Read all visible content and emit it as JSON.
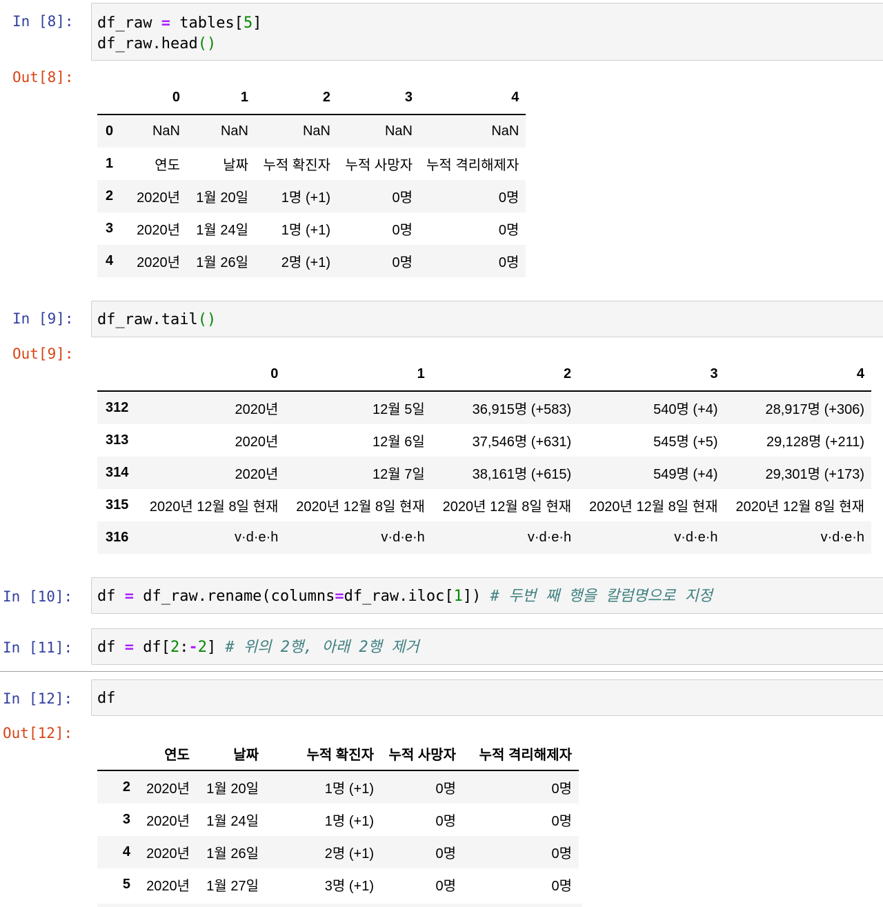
{
  "cells": {
    "c8": {
      "in_prompt": "In [8]:",
      "code_line1_a": "df_raw ",
      "code_line1_op": "=",
      "code_line1_b": " tables[",
      "code_line1_num": "5",
      "code_line1_c": "]",
      "code_line2_a": "df_raw.head",
      "code_line2_paren": "()",
      "out_prompt": "Out[8]:",
      "table": {
        "columns": [
          "0",
          "1",
          "2",
          "3",
          "4"
        ],
        "rows": [
          {
            "index": "0",
            "values": [
              "NaN",
              "NaN",
              "NaN",
              "NaN",
              "NaN"
            ]
          },
          {
            "index": "1",
            "values": [
              "연도",
              "날짜",
              "누적 확진자",
              "누적 사망자",
              "누적 격리해제자"
            ]
          },
          {
            "index": "2",
            "values": [
              "2020년",
              "1월 20일",
              "1명 (+1)",
              "0명",
              "0명"
            ]
          },
          {
            "index": "3",
            "values": [
              "2020년",
              "1월 24일",
              "1명 (+1)",
              "0명",
              "0명"
            ]
          },
          {
            "index": "4",
            "values": [
              "2020년",
              "1월 26일",
              "2명 (+1)",
              "0명",
              "0명"
            ]
          }
        ]
      }
    },
    "c9": {
      "in_prompt": "In [9]:",
      "code_a": "df_raw.tail",
      "code_paren": "()",
      "out_prompt": "Out[9]:",
      "table": {
        "columns": [
          "0",
          "1",
          "2",
          "3",
          "4"
        ],
        "rows": [
          {
            "index": "312",
            "values": [
              "2020년",
              "12월 5일",
              "36,915명 (+583)",
              "540명 (+4)",
              "28,917명 (+306)"
            ]
          },
          {
            "index": "313",
            "values": [
              "2020년",
              "12월 6일",
              "37,546명 (+631)",
              "545명 (+5)",
              "29,128명 (+211)"
            ]
          },
          {
            "index": "314",
            "values": [
              "2020년",
              "12월 7일",
              "38,161명 (+615)",
              "549명 (+4)",
              "29,301명 (+173)"
            ]
          },
          {
            "index": "315",
            "values": [
              "2020년 12월 8일 현재",
              "2020년 12월 8일 현재",
              "2020년 12월 8일 현재",
              "2020년 12월 8일 현재",
              "2020년 12월 8일 현재"
            ]
          },
          {
            "index": "316",
            "values": [
              "v·d·e·h",
              "v·d·e·h",
              "v·d·e·h",
              "v·d·e·h",
              "v·d·e·h"
            ]
          }
        ]
      }
    },
    "c10": {
      "in_prompt": "In [10]:",
      "code_a": "df ",
      "code_op": "=",
      "code_b": " df_raw.rename(columns",
      "code_op2": "=",
      "code_c": "df_raw.iloc[",
      "code_num": "1",
      "code_d": "]) ",
      "code_comment": "# 두번 째 행을 칼럼명으로 지정"
    },
    "c11": {
      "in_prompt": "In [11]:",
      "code_a": "df ",
      "code_op": "=",
      "code_b": " df[",
      "code_num1": "2",
      "code_colon": ":",
      "code_op2": "-",
      "code_num2": "2",
      "code_c": "] ",
      "code_comment": "# 위의 2행, 아래 2행 제거"
    },
    "c12": {
      "in_prompt": "In [12]:",
      "code_a": "df",
      "out_prompt": "Out[12]:",
      "table": {
        "columns": [
          "연도",
          "날짜",
          "누적 확진자",
          "누적 사망자",
          "누적 격리해제자"
        ],
        "rows": [
          {
            "index": "2",
            "values": [
              "2020년",
              "1월 20일",
              "1명 (+1)",
              "0명",
              "0명"
            ]
          },
          {
            "index": "3",
            "values": [
              "2020년",
              "1월 24일",
              "1명 (+1)",
              "0명",
              "0명"
            ]
          },
          {
            "index": "4",
            "values": [
              "2020년",
              "1월 26일",
              "2명 (+1)",
              "0명",
              "0명"
            ]
          },
          {
            "index": "5",
            "values": [
              "2020년",
              "1월 27일",
              "3명 (+1)",
              "0명",
              "0명"
            ]
          }
        ]
      }
    }
  }
}
